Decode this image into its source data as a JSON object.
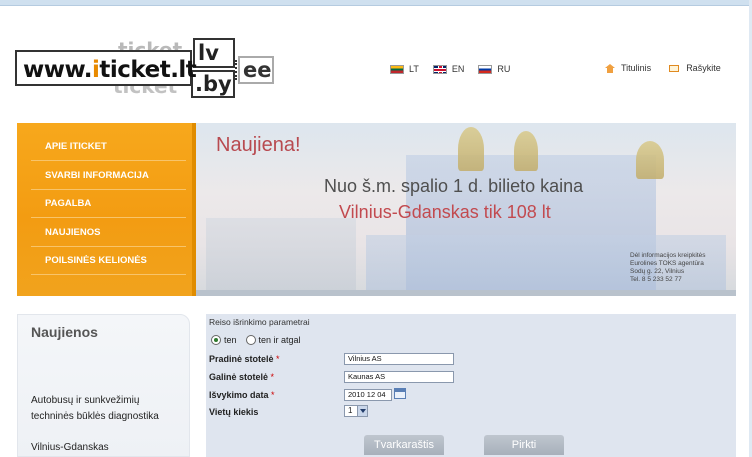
{
  "logo": {
    "ghost_top": "ticket",
    "main_prefix": "www.",
    "main_i": "i",
    "main_suffix": "ticket.lt",
    "lv": "lv",
    "by": ".by",
    "ghost_bottom": "ticket",
    "ee": "ee"
  },
  "languages": [
    {
      "code": "LT",
      "flag": "lt-flag-icon"
    },
    {
      "code": "EN",
      "flag": "uk-flag-icon"
    },
    {
      "code": "RU",
      "flag": "ru-flag-icon"
    }
  ],
  "toplinks": {
    "home": "Titulinis",
    "write": "Rašykite"
  },
  "menu": [
    "APIE ITICKET",
    "SVARBI INFORMACIJA",
    "PAGALBA",
    "NAUJIENOS",
    "POILSINĖS KELIONĖS"
  ],
  "banner": {
    "badge": "Naujiena!",
    "line1": "Nuo š.m. spalio 1 d. bilieto kaina",
    "line2": "Vilnius-Gdanskas tik 108 lt",
    "contact": [
      "Dėl informacijos kreipkitės",
      "Eurolines TOKS agentūra",
      "Sodų g. 22, Vilnius",
      "Tel. 8 5 233 52 77"
    ]
  },
  "news": {
    "title": "Naujienos",
    "item1": "Autobusų ir sunkvežimių techninės būklės diagnostika",
    "item2": "Vilnius-Gdanskas"
  },
  "search": {
    "title": "Reiso išrinkimo parametrai",
    "radio_one_way": "ten",
    "radio_return": "ten ir atgal",
    "from_label": "Pradinė stotelė",
    "from_value": "Vilnius AS",
    "to_label": "Galinė stotelė",
    "to_value": "Kaunas AS",
    "date_label": "Išvykimo data",
    "date_value": "2010 12 04",
    "count_label": "Vietų kiekis",
    "count_value": "1",
    "required_mark": "*",
    "schedule_button": "Tvarkaraštis",
    "buy_button": "Pirkti"
  }
}
